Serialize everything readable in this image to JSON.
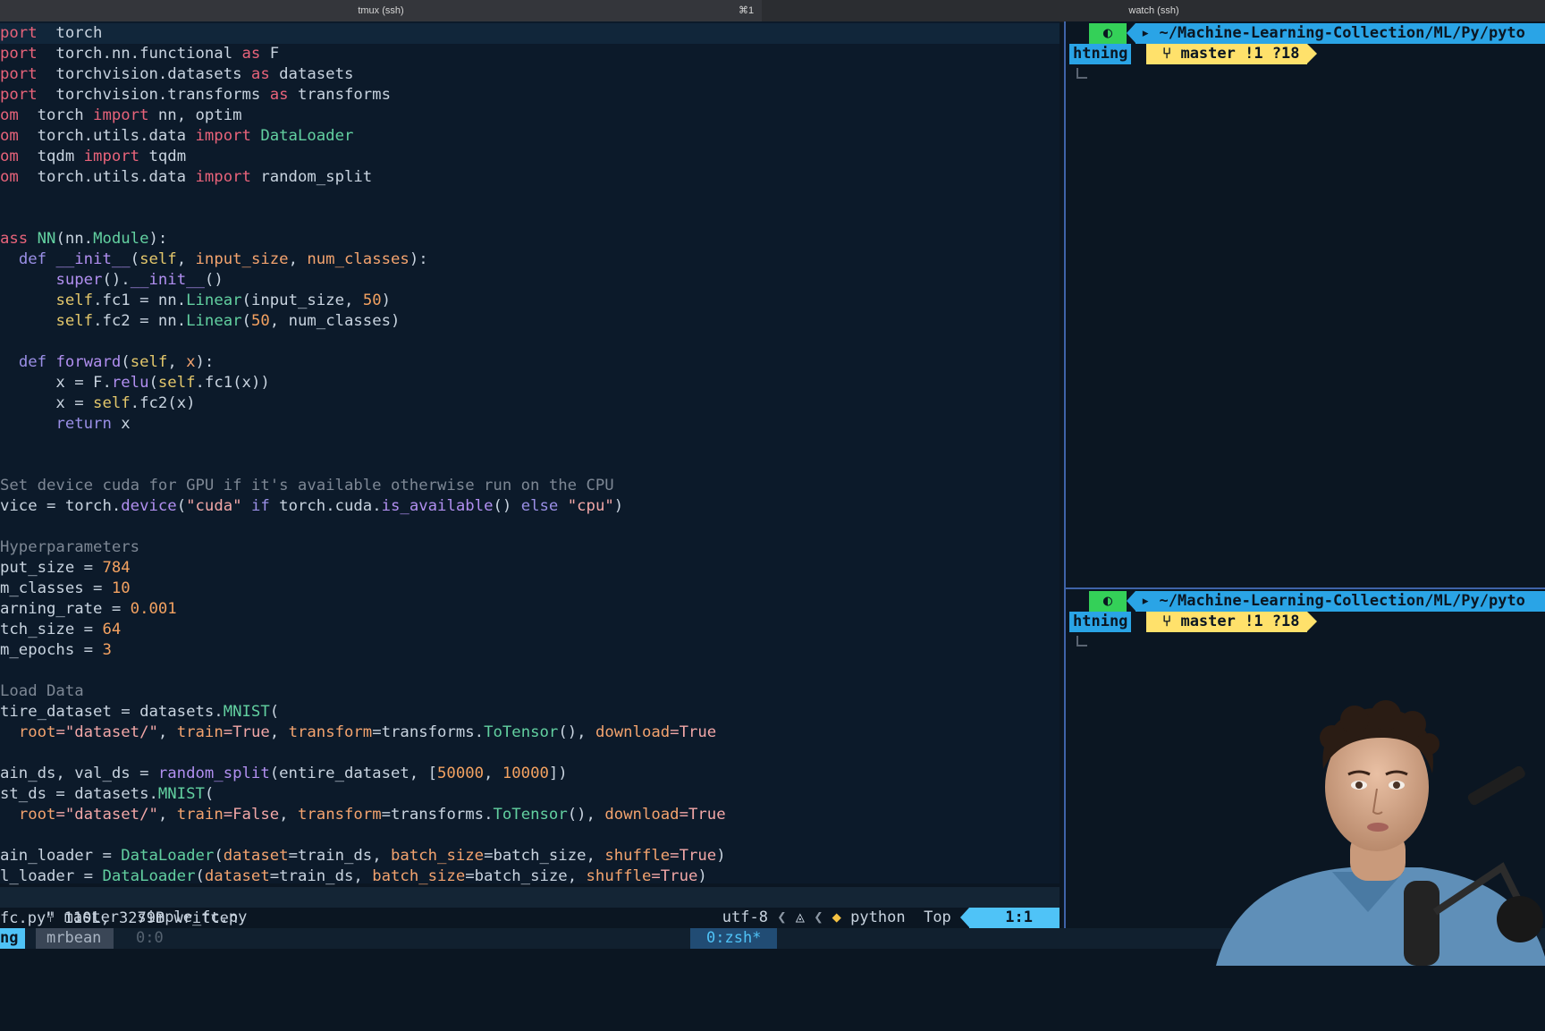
{
  "tabs": {
    "left": "tmux (ssh)",
    "left_shortcut": "⌘1",
    "right": "watch (ssh)"
  },
  "code_lines": [
    [
      [
        "kw",
        "port"
      ],
      [
        "",
        "  torch"
      ]
    ],
    [
      [
        "kw",
        "port"
      ],
      [
        "",
        "  torch.nn.functional "
      ],
      [
        "kw",
        "as"
      ],
      [
        "",
        " F"
      ]
    ],
    [
      [
        "kw",
        "port"
      ],
      [
        "",
        "  torchvision.datasets "
      ],
      [
        "kw",
        "as"
      ],
      [
        "",
        " datasets"
      ]
    ],
    [
      [
        "kw",
        "port"
      ],
      [
        "",
        "  torchvision.transforms "
      ],
      [
        "kw",
        "as"
      ],
      [
        "",
        " transforms"
      ]
    ],
    [
      [
        "kw",
        "om"
      ],
      [
        "",
        "  torch "
      ],
      [
        "kw",
        "import"
      ],
      [
        "",
        " nn, optim"
      ]
    ],
    [
      [
        "kw",
        "om"
      ],
      [
        "",
        "  torch.utils.data "
      ],
      [
        "kw",
        "import"
      ],
      [
        "",
        " "
      ],
      [
        "fn",
        "DataLoader"
      ]
    ],
    [
      [
        "kw",
        "om"
      ],
      [
        "",
        "  tqdm "
      ],
      [
        "kw",
        "import"
      ],
      [
        "",
        " tqdm"
      ]
    ],
    [
      [
        "kw",
        "om"
      ],
      [
        "",
        "  torch.utils.data "
      ],
      [
        "kw",
        "import"
      ],
      [
        "",
        " random_split"
      ]
    ],
    [],
    [],
    [
      [
        "kw",
        "ass"
      ],
      [
        "",
        " "
      ],
      [
        "fn",
        "NN"
      ],
      [
        "",
        "(nn."
      ],
      [
        "fn",
        "Module"
      ],
      [
        "",
        "):"
      ]
    ],
    [
      [
        "",
        "  "
      ],
      [
        "kw2",
        "def"
      ],
      [
        "",
        " "
      ],
      [
        "meth",
        "__init__"
      ],
      [
        "",
        "("
      ],
      [
        "slf",
        "self"
      ],
      [
        "",
        ", "
      ],
      [
        "prm",
        "input_size"
      ],
      [
        "",
        ", "
      ],
      [
        "prm",
        "num_classes"
      ],
      [
        "",
        "):"
      ]
    ],
    [
      [
        "",
        "      "
      ],
      [
        "meth",
        "super"
      ],
      [
        "",
        "()."
      ],
      [
        "meth",
        "__init__"
      ],
      [
        "",
        "()"
      ]
    ],
    [
      [
        "",
        "      "
      ],
      [
        "slf",
        "self"
      ],
      [
        "",
        ".fc1 = nn."
      ],
      [
        "fn",
        "Linear"
      ],
      [
        "",
        "(input_size, "
      ],
      [
        "num",
        "50"
      ],
      [
        "",
        ")"
      ]
    ],
    [
      [
        "",
        "      "
      ],
      [
        "slf",
        "self"
      ],
      [
        "",
        ".fc2 = nn."
      ],
      [
        "fn",
        "Linear"
      ],
      [
        "",
        "("
      ],
      [
        "num",
        "50"
      ],
      [
        "",
        ", num_classes)"
      ]
    ],
    [],
    [
      [
        "",
        "  "
      ],
      [
        "kw2",
        "def"
      ],
      [
        "",
        " "
      ],
      [
        "meth",
        "forward"
      ],
      [
        "",
        "("
      ],
      [
        "slf",
        "self"
      ],
      [
        "",
        ", "
      ],
      [
        "prm",
        "x"
      ],
      [
        "",
        "):"
      ]
    ],
    [
      [
        "",
        "      x = F."
      ],
      [
        "meth",
        "relu"
      ],
      [
        "",
        "("
      ],
      [
        "slf",
        "self"
      ],
      [
        "",
        ".fc1(x))"
      ]
    ],
    [
      [
        "",
        "      x = "
      ],
      [
        "slf",
        "self"
      ],
      [
        "",
        ".fc2(x)"
      ]
    ],
    [
      [
        "",
        "      "
      ],
      [
        "kw2",
        "return"
      ],
      [
        "",
        " x"
      ]
    ],
    [],
    [],
    [
      [
        "cm",
        "Set device cuda for GPU if it's available otherwise run on the CPU"
      ]
    ],
    [
      [
        "",
        "vice = torch."
      ],
      [
        "meth",
        "device"
      ],
      [
        "",
        "("
      ],
      [
        "str",
        "\"cuda\""
      ],
      [
        "",
        " "
      ],
      [
        "kw2",
        "if"
      ],
      [
        "",
        " torch.cuda."
      ],
      [
        "meth",
        "is_available"
      ],
      [
        "",
        "() "
      ],
      [
        "kw2",
        "else"
      ],
      [
        "",
        " "
      ],
      [
        "str",
        "\"cpu\""
      ],
      [
        "",
        ")"
      ]
    ],
    [],
    [
      [
        "cm",
        "Hyperparameters"
      ]
    ],
    [
      [
        "",
        "put_size = "
      ],
      [
        "num",
        "784"
      ]
    ],
    [
      [
        "",
        "m_classes = "
      ],
      [
        "num",
        "10"
      ]
    ],
    [
      [
        "",
        "arning_rate = "
      ],
      [
        "num",
        "0.001"
      ]
    ],
    [
      [
        "",
        "tch_size = "
      ],
      [
        "num",
        "64"
      ]
    ],
    [
      [
        "",
        "m_epochs = "
      ],
      [
        "num",
        "3"
      ]
    ],
    [],
    [
      [
        "cm",
        "Load Data"
      ]
    ],
    [
      [
        "",
        "tire_dataset = datasets."
      ],
      [
        "fn",
        "MNIST"
      ],
      [
        "",
        "("
      ]
    ],
    [
      [
        "",
        "  "
      ],
      [
        "prm",
        "root"
      ],
      [
        "str",
        "=\"dataset/\""
      ],
      [
        "",
        ", "
      ],
      [
        "prm",
        "train"
      ],
      [
        "str",
        "=True"
      ],
      [
        "",
        ", "
      ],
      [
        "prm",
        "transform"
      ],
      [
        "",
        "=transforms."
      ],
      [
        "fn",
        "ToTensor"
      ],
      [
        "",
        "(), "
      ],
      [
        "prm",
        "download"
      ],
      [
        "str",
        "=True"
      ]
    ],
    [],
    [
      [
        "",
        "ain_ds, val_ds = "
      ],
      [
        "meth",
        "random_split"
      ],
      [
        "",
        "(entire_dataset, ["
      ],
      [
        "num",
        "50000"
      ],
      [
        "",
        ", "
      ],
      [
        "num",
        "10000"
      ],
      [
        "",
        "])"
      ]
    ],
    [
      [
        "",
        "st_ds = datasets."
      ],
      [
        "fn",
        "MNIST"
      ],
      [
        "",
        "("
      ]
    ],
    [
      [
        "",
        "  "
      ],
      [
        "prm",
        "root"
      ],
      [
        "str",
        "=\"dataset/\""
      ],
      [
        "",
        ", "
      ],
      [
        "prm",
        "train"
      ],
      [
        "str",
        "=False"
      ],
      [
        "",
        ", "
      ],
      [
        "prm",
        "transform"
      ],
      [
        "",
        "=transforms."
      ],
      [
        "fn",
        "ToTensor"
      ],
      [
        "",
        "(), "
      ],
      [
        "prm",
        "download"
      ],
      [
        "str",
        "=True"
      ]
    ],
    [],
    [
      [
        "",
        "ain_loader = "
      ],
      [
        "fn",
        "DataLoader"
      ],
      [
        "",
        "("
      ],
      [
        "prm",
        "dataset"
      ],
      [
        "",
        "=train_ds, "
      ],
      [
        "prm",
        "batch_size"
      ],
      [
        "",
        "=batch_size, "
      ],
      [
        "prm",
        "shuffle"
      ],
      [
        "str",
        "=True"
      ],
      [
        "",
        ")"
      ]
    ],
    [
      [
        "",
        "l_loader = "
      ],
      [
        "fn",
        "DataLoader"
      ],
      [
        "",
        "("
      ],
      [
        "prm",
        "dataset"
      ],
      [
        "",
        "=train_ds, "
      ],
      [
        "prm",
        "batch_size"
      ],
      [
        "",
        "=batch_size, "
      ],
      [
        "prm",
        "shuffle"
      ],
      [
        "str",
        "=True"
      ],
      [
        "",
        ")"
      ]
    ]
  ],
  "statusline": {
    "branch_icon": "branch-icon",
    "branch": "master",
    "filename": "simple_fc.py",
    "encoding": "utf-8",
    "os_icon": "linux-icon",
    "filetype_icon": "python-icon",
    "filetype": "python",
    "scroll": "Top",
    "position": "1:1"
  },
  "cmdline": "fc.py\" 110L, 3279B written",
  "shell_prompt": {
    "os_glyph": "◐",
    "folder_glyph": "▸",
    "path": "~/Machine-Learning-Collection/ML/Py/pyto",
    "path_tail": "htning",
    "git_glyph": "⑂",
    "git_status": "master !1 ?18"
  },
  "tmux": {
    "session": "ng",
    "host": "mrbean",
    "pane": "0:0",
    "window": "0:zsh*"
  }
}
